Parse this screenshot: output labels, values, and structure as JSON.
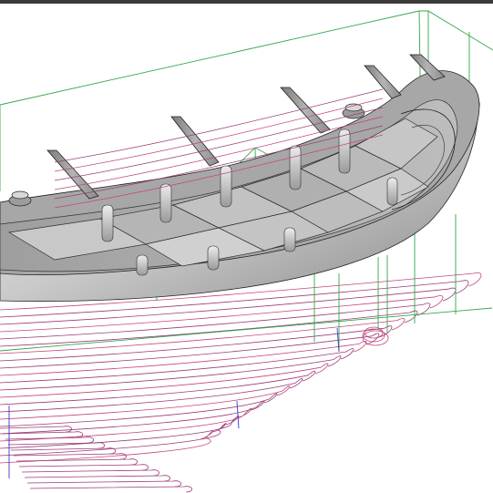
{
  "colors": {
    "background": "#ffffff",
    "window_border": "#3b3b3b",
    "toolpath_primary": "#9a3b7a",
    "toolpath_secondary": "#c2457e",
    "stock_boundary": "#2fa84a",
    "link_moves": "#3a3ac8",
    "part_body_light": "#dcdcdc",
    "part_body_mid": "#a9a9a9",
    "part_body_dark": "#6e6e6e",
    "part_edge": "#222222"
  },
  "objects": {
    "part": "machined-pocketed-shell",
    "toolpath": "cnc-contour-toolpath",
    "stock": "stock-boundary-box"
  }
}
